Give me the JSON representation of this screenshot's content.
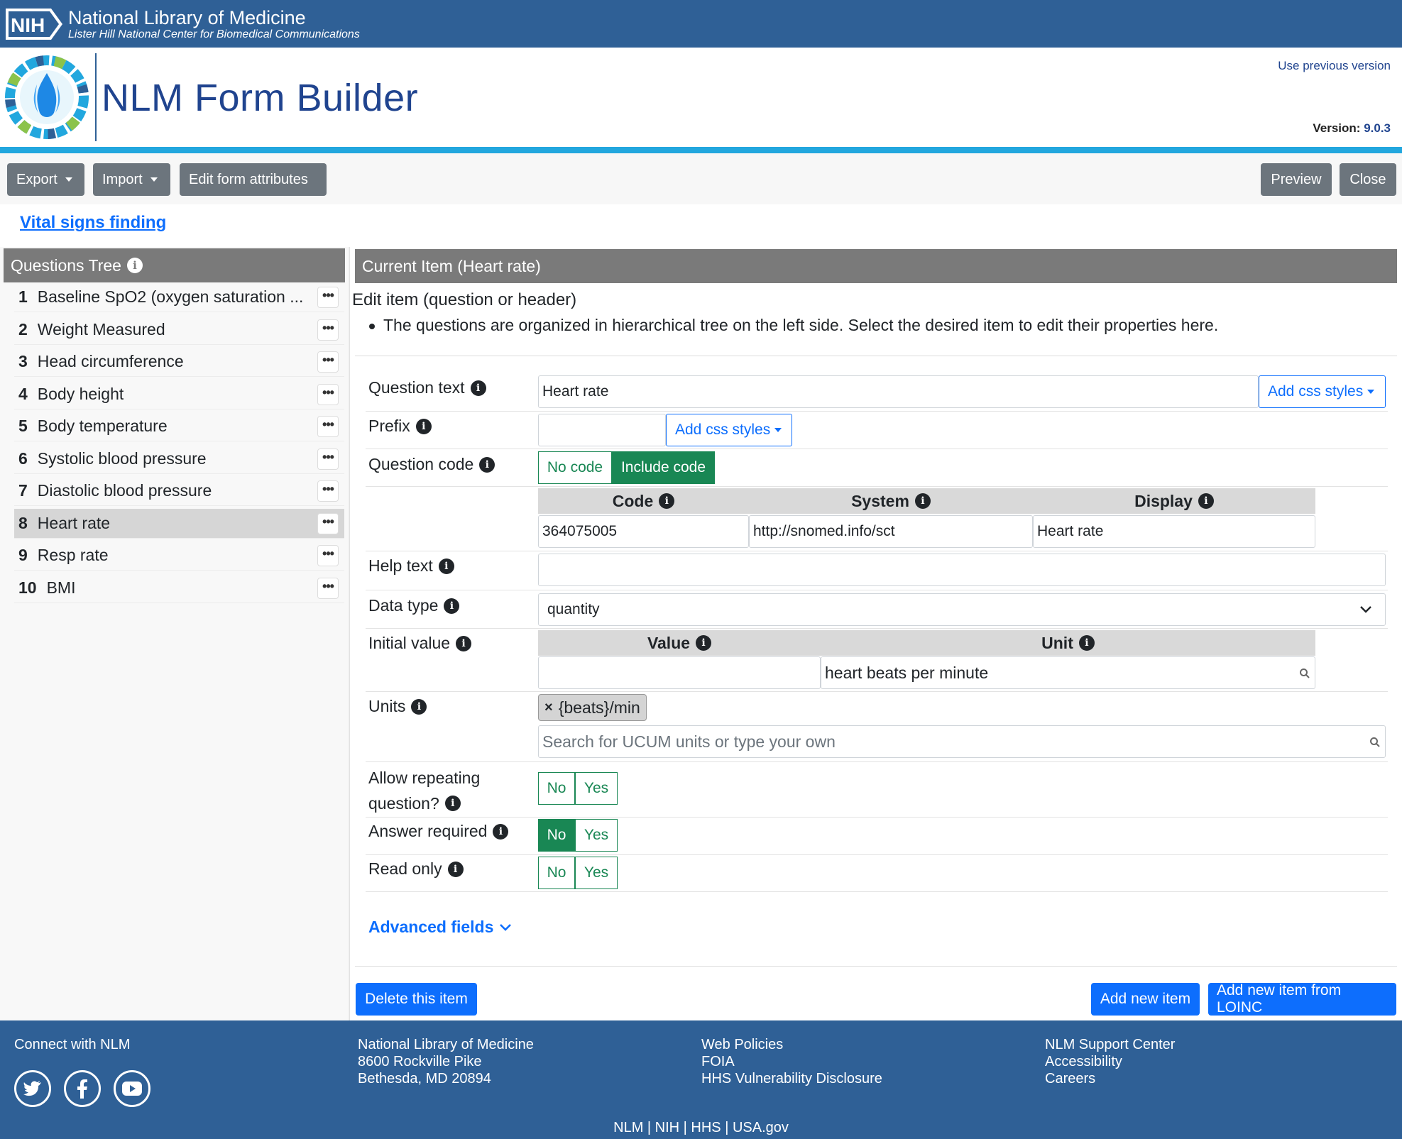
{
  "nih": {
    "logo_text": "NIH",
    "title": "National Library of Medicine",
    "subtitle": "Lister Hill National Center for Biomedical Communications"
  },
  "header": {
    "app_title": "NLM Form Builder",
    "prev_version_link": "Use previous version",
    "version_label": "Version:",
    "version_number": "9.0.3"
  },
  "toolbar": {
    "export_label": "Export",
    "import_label": "Import",
    "edit_attrs_label": "Edit form attributes",
    "preview_label": "Preview",
    "close_label": "Close"
  },
  "form_title": "Vital signs finding",
  "tree": {
    "title": "Questions Tree",
    "items": [
      {
        "num": "1",
        "label": "Baseline SpO2 (oxygen saturation ..."
      },
      {
        "num": "2",
        "label": "Weight Measured"
      },
      {
        "num": "3",
        "label": "Head circumference"
      },
      {
        "num": "4",
        "label": "Body height"
      },
      {
        "num": "5",
        "label": "Body temperature"
      },
      {
        "num": "6",
        "label": "Systolic blood pressure"
      },
      {
        "num": "7",
        "label": "Diastolic blood pressure"
      },
      {
        "num": "8",
        "label": "Heart rate"
      },
      {
        "num": "9",
        "label": "Resp rate"
      },
      {
        "num": "10",
        "label": "BMI"
      }
    ],
    "selected_index": 7
  },
  "editor": {
    "panel_title": "Current Item (Heart rate)",
    "heading": "Edit item (question or header)",
    "note": "The questions are organized in hierarchical tree on the left side. Select the desired item to edit their properties here.",
    "question_text_label": "Question text",
    "question_text_value": "Heart rate",
    "add_css_label": "Add css styles",
    "prefix_label": "Prefix",
    "prefix_value": "",
    "question_code_label": "Question code",
    "no_code_label": "No code",
    "include_code_label": "Include code",
    "code_header": "Code",
    "system_header": "System",
    "display_header": "Display",
    "code_value": "364075005",
    "system_value": "http://snomed.info/sct",
    "display_value": "Heart rate",
    "help_text_label": "Help text",
    "help_text_value": "",
    "data_type_label": "Data type",
    "data_type_value": "quantity",
    "initial_value_label": "Initial value",
    "value_header": "Value",
    "unit_header": "Unit",
    "initial_value": "",
    "unit_value": "heart beats per minute",
    "units_label": "Units",
    "unit_chip": "{beats}/min",
    "units_search_placeholder": "Search for UCUM units or type your own",
    "allow_repeat_label_1": "Allow repeating",
    "allow_repeat_label_2": "question?",
    "answer_required_label": "Answer required",
    "read_only_label": "Read only",
    "no_label": "No",
    "yes_label": "Yes",
    "advanced_fields_label": "Advanced fields",
    "delete_label": "Delete this item",
    "add_new_label": "Add new item",
    "add_loinc_label": "Add new item from LOINC"
  },
  "footer": {
    "connect_title": "Connect with NLM",
    "address": [
      "National Library of Medicine",
      "8600 Rockville Pike",
      "Bethesda, MD 20894"
    ],
    "policies": [
      "Web Policies",
      "FOIA",
      "HHS Vulnerability Disclosure"
    ],
    "support": [
      "NLM Support Center",
      "Accessibility",
      "Careers"
    ],
    "bottom_links": "NLM | NIH | HHS | USA.gov"
  },
  "colors": {
    "banner": "#2f6096",
    "accent": "#22a7de",
    "primary": "#0d6efd",
    "success": "#198754",
    "secondary": "#6c757d"
  }
}
